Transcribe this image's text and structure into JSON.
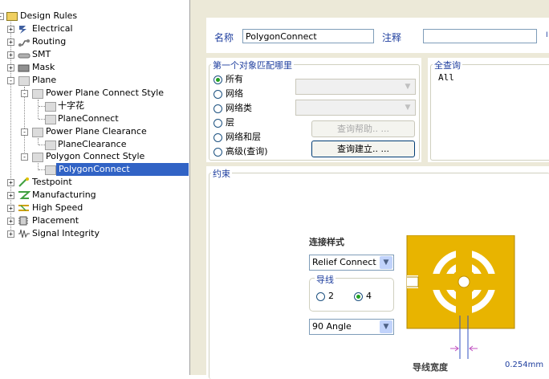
{
  "tree": {
    "root": {
      "label": "Design Rules"
    },
    "items": [
      {
        "label": "Electrical",
        "icon": "electrical-icon"
      },
      {
        "label": "Routing",
        "icon": "routing-icon"
      },
      {
        "label": "SMT",
        "icon": "smt-icon"
      },
      {
        "label": "Mask",
        "icon": "mask-icon"
      },
      {
        "label": "Plane",
        "icon": "plane-icon"
      },
      {
        "label": "Power Plane Connect Style"
      },
      {
        "label": "十字花"
      },
      {
        "label": "PlaneConnect"
      },
      {
        "label": "Power Plane Clearance"
      },
      {
        "label": "PlaneClearance"
      },
      {
        "label": "Polygon Connect Style"
      },
      {
        "label": "PolygonConnect"
      },
      {
        "label": "Testpoint",
        "icon": "testpoint-icon"
      },
      {
        "label": "Manufacturing",
        "icon": "manufacturing-icon"
      },
      {
        "label": "High Speed",
        "icon": "high-speed-icon"
      },
      {
        "label": "Placement",
        "icon": "placement-icon"
      },
      {
        "label": "Signal Integrity",
        "icon": "signal-integrity-icon"
      }
    ]
  },
  "header": {
    "name_label": "名称",
    "name_value": "PolygonConnect",
    "comment_label": "注释",
    "comment_value": ""
  },
  "first_object": {
    "title": "第一个对象匹配哪里",
    "options": [
      "所有",
      "网络",
      "网络类",
      "层",
      "网络和层",
      "高级(查询)"
    ],
    "selected": "所有",
    "query_help_label": "查询帮助.. ...",
    "query_builder_label": "查询建立.. ..."
  },
  "full_query": {
    "title": "全查询",
    "text": "All"
  },
  "constraints": {
    "title": "约束",
    "connect_style_label": "连接样式",
    "connect_style_value": "Relief Connect",
    "conductors_label": "导线",
    "conductor_options": [
      "2",
      "4"
    ],
    "conductor_selected": "4",
    "angle_value": "90 Angle",
    "width_label": "导线宽度",
    "width_value": "0.254mm"
  },
  "colors": {
    "selection": "#3163c5",
    "copper": "#e8b400",
    "label_blue": "#1f3f9f"
  }
}
